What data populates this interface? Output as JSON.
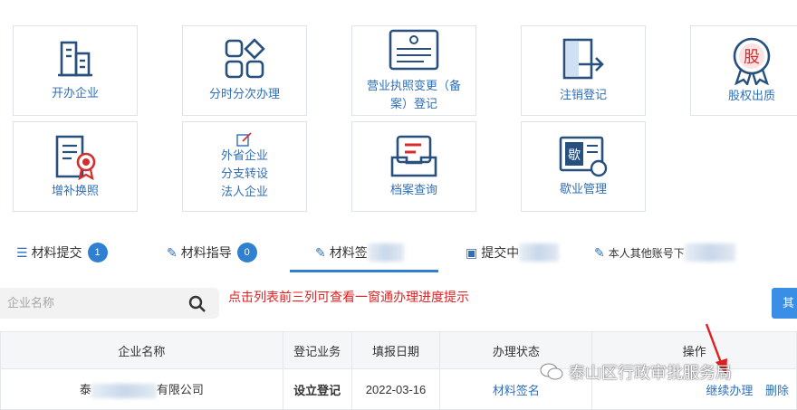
{
  "tiles": [
    {
      "label": "开办企业",
      "icon": "building-icon"
    },
    {
      "label": "分时分次办理",
      "icon": "grid-icon"
    },
    {
      "label": "营业执照变更（备案）登记",
      "icon": "license-icon"
    },
    {
      "label": "注销登记",
      "icon": "logout-icon"
    },
    {
      "label": "股权出质",
      "icon": "equity-seal-icon"
    },
    {
      "label": "增补换照",
      "icon": "certificate-icon"
    },
    {
      "label_lines": [
        "外省企业",
        "分支转设",
        "法人企业"
      ],
      "icon": "edit-icon"
    },
    {
      "label": "档案查询",
      "icon": "archive-icon"
    },
    {
      "label": "歇业管理",
      "icon": "suspend-card-icon"
    }
  ],
  "tabs": [
    {
      "label": "材料提交",
      "badge": "1",
      "icon": "list-icon"
    },
    {
      "label": "材料指导",
      "badge": "0",
      "icon": "edit-icon"
    },
    {
      "label": "材料签",
      "icon": "edit-icon",
      "active": true
    },
    {
      "label": "提交中",
      "icon": "briefcase-icon"
    },
    {
      "label": "本人其他账号下",
      "icon": "edit-icon"
    }
  ],
  "search": {
    "placeholder": "企业名称"
  },
  "hint": "点击列表前三列可查看一窗通办理进度提示",
  "other_button": "其",
  "table": {
    "headers": [
      "企业名称",
      "登记业务",
      "填报日期",
      "办理状态",
      "操作"
    ],
    "rows": [
      {
        "company_prefix": "泰",
        "company_suffix": "有限公司",
        "business": "设立登记",
        "date": "2022-03-16",
        "status": "材料签名",
        "actions": [
          "继续办理",
          "删除"
        ]
      }
    ]
  },
  "watermark": "泰山区行政审批服务局",
  "colors": {
    "accent": "#2f6fb8",
    "badge": "#2f80d1",
    "hint_red": "#e02020",
    "arrow_red": "#e02020"
  }
}
